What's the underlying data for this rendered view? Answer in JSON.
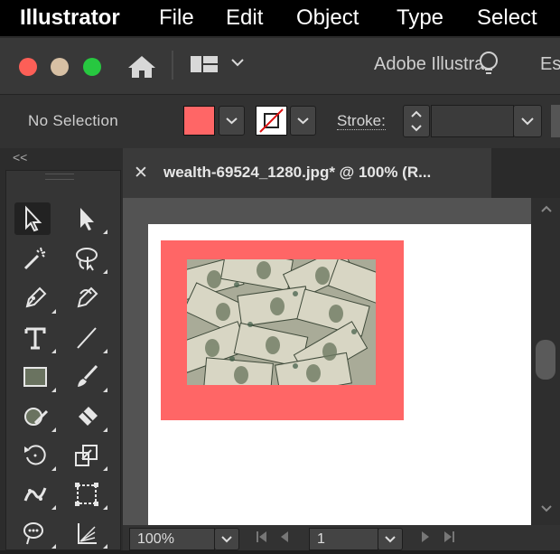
{
  "menubar": {
    "app_name": "Illustrator",
    "items": [
      "File",
      "Edit",
      "Object",
      "Type",
      "Select"
    ]
  },
  "window": {
    "title": "Adobe Illustrat",
    "right_cut_text": "Es"
  },
  "controlbar": {
    "selection_status": "No Selection",
    "fill_color": "#ff6666",
    "stroke_label": "Stroke:"
  },
  "toolbar": {
    "collapse_label": "<<",
    "tools": [
      "selection-tool",
      "direct-selection-tool",
      "magic-wand-tool",
      "lasso-tool",
      "pen-tool",
      "curvature-tool",
      "type-tool",
      "line-segment-tool",
      "rectangle-tool",
      "paintbrush-tool",
      "shaper-tool",
      "eraser-tool",
      "rotate-tool",
      "scale-tool",
      "puppet-warp-tool",
      "free-transform-tool",
      "symbol-sprayer-tool",
      "graph-tool"
    ]
  },
  "document": {
    "tab_close": "✕",
    "tab_title": "wealth-69524_1280.jpg* @ 100% (R..."
  },
  "statusbar": {
    "zoom": "100%",
    "page": "1"
  },
  "colors": {
    "accent_red": "#ff6666",
    "traffic_close": "#fd5f57",
    "traffic_minimize": "#d7c0a4",
    "traffic_zoom": "#27c840"
  }
}
